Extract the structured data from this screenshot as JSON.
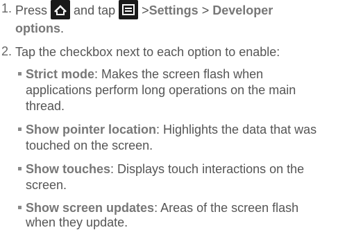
{
  "steps": [
    {
      "number": "1.",
      "pre": "Press",
      "and_tap": "and tap",
      "path": [
        ">",
        "Settings",
        ">",
        "Developer"
      ],
      "path_cont": "options",
      "period": "."
    },
    {
      "number": "2.",
      "text": "Tap the checkbox next to each option to enable:"
    }
  ],
  "options": [
    {
      "name": "Strict mode",
      "desc_lines": [
        ": Makes the screen flash when",
        "applications perform long operations on the main",
        "thread."
      ]
    },
    {
      "name": "Show pointer location",
      "desc_lines": [
        ": Highlights the data that was",
        "touched on the screen."
      ]
    },
    {
      "name": "Show touches",
      "desc_lines": [
        ": Displays touch interactions on the",
        "screen."
      ]
    },
    {
      "name": "Show screen updates",
      "desc_lines": [
        ": Areas of the screen flash",
        "when they update."
      ]
    }
  ],
  "icons": {
    "home": "home-icon",
    "menu": "menu-icon"
  }
}
